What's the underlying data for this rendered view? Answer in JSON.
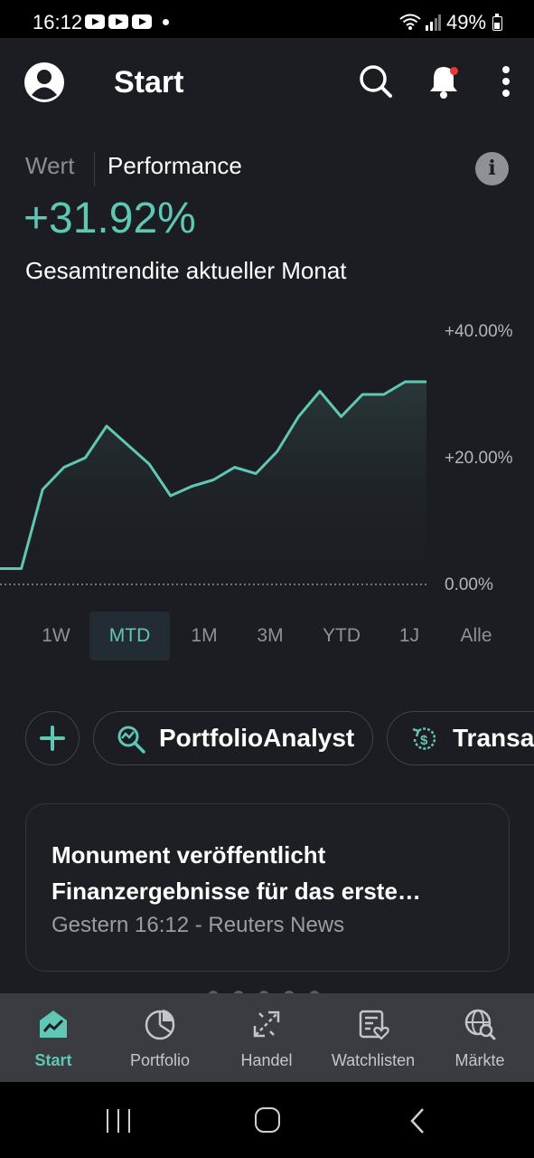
{
  "statusbar": {
    "time": "16:12",
    "battery": "49%",
    "icons": [
      "youtube-icon",
      "youtube-icon",
      "youtube-icon",
      "notification-dot",
      "wifi-icon",
      "signal-icon",
      "battery-icon"
    ]
  },
  "header": {
    "title": "Start",
    "icons": [
      "account-icon",
      "search-icon",
      "bell-icon",
      "more-vertical-icon"
    ]
  },
  "summary": {
    "tab_value": "Wert",
    "tab_performance": "Performance",
    "value": "+31.92%",
    "subtitle": "Gesamtrendite aktueller Monat",
    "accent_color": "#5fc7b3"
  },
  "chart_data": {
    "type": "area",
    "x": [
      1,
      2,
      3,
      4,
      5,
      6,
      7,
      8,
      9,
      10,
      11,
      12,
      13,
      14,
      15,
      16,
      17,
      18,
      19,
      20,
      21,
      22
    ],
    "values": [
      2.5,
      2.5,
      15,
      18.5,
      20,
      25,
      22,
      19,
      14,
      15.5,
      16.5,
      18.5,
      17.5,
      21,
      26.5,
      30.5,
      26.5,
      30,
      30,
      32,
      32
    ],
    "ylim": [
      0,
      40
    ],
    "yticks": [
      "+40.00%",
      "+20.00%",
      "0.00%"
    ],
    "baseline_dotted": true,
    "grid": false,
    "line_color": "#5fc7b3"
  },
  "ranges": [
    "1W",
    "MTD",
    "1M",
    "3M",
    "YTD",
    "1J",
    "Alle"
  ],
  "active_range": "MTD",
  "chips": {
    "add": "plus-icon",
    "analyst": "PortfolioAnalyst",
    "transactions": "Transa"
  },
  "news": {
    "title_line1": "Monument veröffentlicht",
    "title_line2": "Finanzergebnisse für das erste…",
    "meta": "Gestern 16:12 - Reuters News"
  },
  "bottomnav": [
    {
      "label": "Start",
      "icon": "chart-home-icon",
      "active": true
    },
    {
      "label": "Portfolio",
      "icon": "pie-chart-icon",
      "active": false
    },
    {
      "label": "Handel",
      "icon": "trade-arrows-icon",
      "active": false
    },
    {
      "label": "Watchlisten",
      "icon": "watchlist-heart-icon",
      "active": false
    },
    {
      "label": "Märkte",
      "icon": "globe-search-icon",
      "active": false
    }
  ]
}
